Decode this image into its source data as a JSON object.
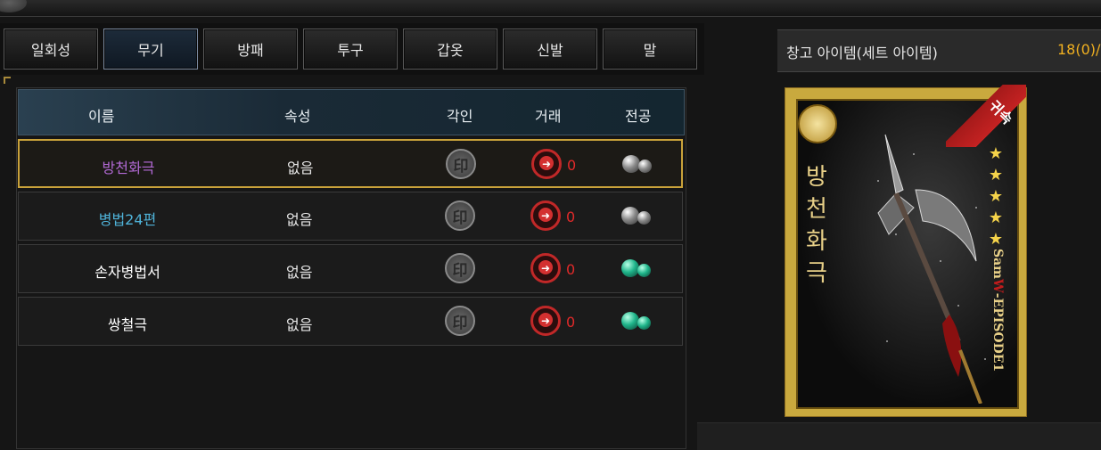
{
  "tabs": [
    {
      "label": "일회성",
      "active": false
    },
    {
      "label": "무기",
      "active": true
    },
    {
      "label": "방패",
      "active": false
    },
    {
      "label": "투구",
      "active": false
    },
    {
      "label": "갑옷",
      "active": false
    },
    {
      "label": "신발",
      "active": false
    },
    {
      "label": "말",
      "active": false
    }
  ],
  "storage": {
    "title": "창고 아이템(세트 아이템)",
    "count": "18(0)/"
  },
  "columns": {
    "name": "이름",
    "attribute": "속성",
    "engrave": "각인",
    "trade": "거래",
    "merit": "전공"
  },
  "items": [
    {
      "name": "방천화극",
      "name_color": "#b36ad6",
      "attribute": "없음",
      "seal_glyph": "印",
      "trade_count": "0",
      "merit_orb": "grey",
      "selected": true
    },
    {
      "name": "병법24편",
      "name_color": "#4fb3d9",
      "attribute": "없음",
      "seal_glyph": "印",
      "trade_count": "0",
      "merit_orb": "grey",
      "selected": false
    },
    {
      "name": "손자병법서",
      "name_color": "#ffffff",
      "attribute": "없음",
      "seal_glyph": "印",
      "trade_count": "0",
      "merit_orb": "green",
      "selected": false
    },
    {
      "name": "쌍철극",
      "name_color": "#ffffff",
      "attribute": "없음",
      "seal_glyph": "印",
      "trade_count": "0",
      "merit_orb": "green",
      "selected": false
    }
  ],
  "card": {
    "vertical_title": "방천화극",
    "ribbon": "귀속",
    "stars": 5,
    "episode_prefix": "Sam",
    "episode_highlight": "W",
    "episode_suffix": "-EPISODE1"
  },
  "colors": {
    "accent_gold": "#c9a23a",
    "count_orange": "#f0b020",
    "trade_red": "#e02a2a"
  }
}
